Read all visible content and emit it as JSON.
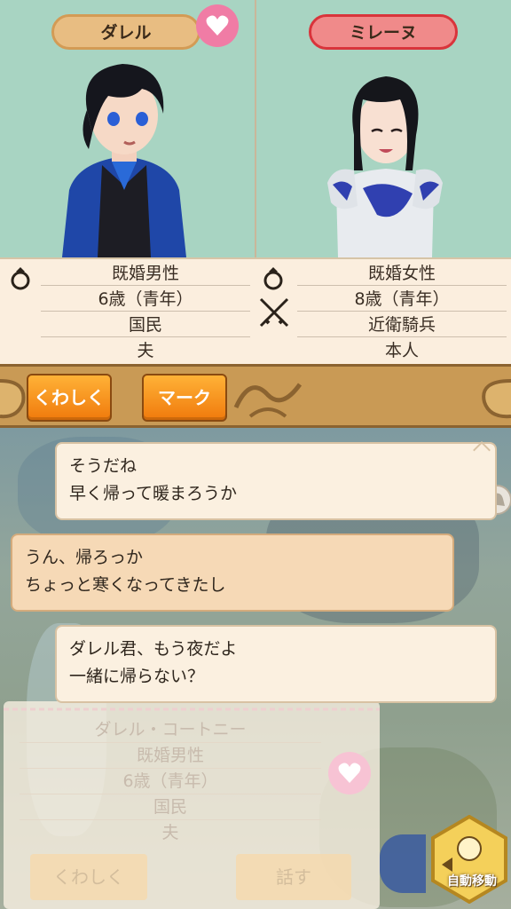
{
  "left_character": {
    "name": "ダレル",
    "marital_status": "既婚男性",
    "age": "6歳（青年）",
    "occupation": "国民",
    "relation": "夫"
  },
  "right_character": {
    "name": "ミレーヌ",
    "marital_status": "既婚女性",
    "age": "8歳（青年）",
    "occupation": "近衛騎兵",
    "relation": "本人"
  },
  "actions": {
    "details_label": "くわしく",
    "mark_label": "マーク"
  },
  "dialogue": [
    {
      "speaker": "ダレル",
      "lines": [
        "そうだね",
        "早く帰って暖まろうか"
      ]
    },
    {
      "speaker": "ミレーヌ",
      "lines": [
        "うん、帰ろっか",
        "ちょっと寒くなってきたし"
      ]
    },
    {
      "speaker": "ダレル",
      "lines": [
        "ダレル君、もう夜だよ",
        "一緒に帰らない？"
      ]
    }
  ],
  "background_card": {
    "full_name": "ダレル・コートニー",
    "marital_status": "既婚男性",
    "age": "6歳（青年）",
    "occupation": "国民",
    "relation": "夫",
    "details_label": "くわしく",
    "talk_label": "話す"
  },
  "auto_move_label": "自動移動",
  "colors": {
    "portrait_bg": "#a8d4c2",
    "left_tag": "#e8bd82",
    "right_tag": "#f08a8a",
    "heart": "#f07ca5",
    "orange_button": "#f59320",
    "ornament_bar": "#c99a55"
  },
  "icons": [
    "heart-icon",
    "ring-icon",
    "crossed-swords-icon",
    "speech-toggle-icon",
    "auto-move-icon"
  ]
}
